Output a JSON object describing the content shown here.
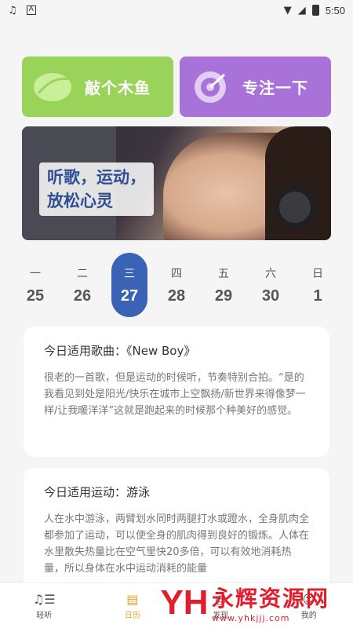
{
  "status_bar": {
    "time": "5:50",
    "left_icons": [
      "music-note-icon",
      "font-a-icon"
    ],
    "right_icons": [
      "wifi-icon",
      "signal-icon",
      "battery-icon"
    ]
  },
  "cards": [
    {
      "title": "敲个木鱼",
      "icon": "wooden-fish-icon",
      "color": "#9ad35a"
    },
    {
      "title": "专注一下",
      "icon": "focus-target-icon",
      "color": "#a872d8"
    }
  ],
  "banner": {
    "line1": "听歌，运动，",
    "line2": "放松心灵"
  },
  "week": [
    {
      "weekday": "一",
      "date": "25"
    },
    {
      "weekday": "二",
      "date": "26"
    },
    {
      "weekday": "三",
      "date": "27",
      "active": true
    },
    {
      "weekday": "四",
      "date": "28"
    },
    {
      "weekday": "五",
      "date": "29"
    },
    {
      "weekday": "六",
      "date": "30"
    },
    {
      "weekday": "日",
      "date": "1"
    }
  ],
  "song": {
    "heading": "今日适用歌曲：《New Boy》",
    "body": "很老的一首歌，但是运动的时候听，节奏特别合拍。“是的我看见到处是阳光/快乐在城市上空飘扬/新世界来得像梦一样/让我暖洋洋”这就是跑起来的时候那个种美好的感觉。"
  },
  "sport": {
    "heading": "今日适用运动：游泳",
    "body": "人在水中游泳，两臂划水同时两腿打水或蹬水，全身肌肉全都参加了运动，可以使全身的肌肉得到良好的锻炼。人体在水里散失热量比在空气里快20多倍，可以有效地消耗热量，所以身体在水中运动消耗的能量"
  },
  "nav": [
    {
      "label": "轻听",
      "icon": "music-list-icon"
    },
    {
      "label": "日历",
      "icon": "calendar-icon",
      "active": true
    },
    {
      "label": "发现",
      "icon": "discover-icon"
    },
    {
      "label": "我的",
      "icon": "profile-icon"
    }
  ],
  "watermark": {
    "title": "永辉资源网",
    "url": "www.yhkjjj.com"
  },
  "colors": {
    "active_day": "#3a62b5",
    "nav_active": "#e6a023"
  }
}
